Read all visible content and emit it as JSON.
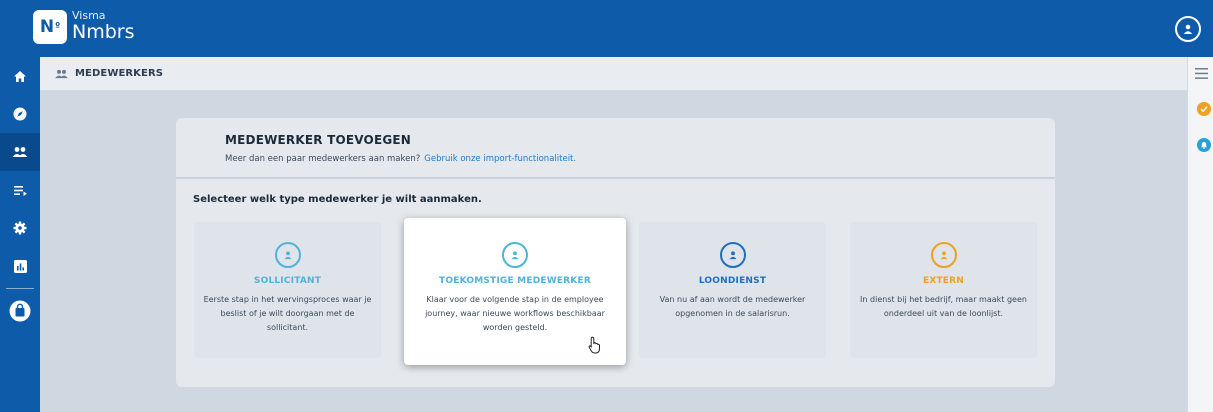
{
  "brand": {
    "logo_mark": "N",
    "logo_sup": "º",
    "small": "Visma",
    "big": "Nmbrs"
  },
  "header": {
    "user_icon": "user-avatar-icon"
  },
  "sidebar": {
    "items": [
      {
        "icon": "home-icon"
      },
      {
        "icon": "compass-icon"
      },
      {
        "icon": "employees-icon",
        "active": true
      },
      {
        "icon": "list-icon"
      },
      {
        "icon": "gear-icon"
      },
      {
        "icon": "chart-icon"
      },
      {
        "icon": "bag-icon"
      }
    ]
  },
  "breadcrumb": {
    "label": "MEDEWERKERS"
  },
  "card": {
    "title": "MEDEWERKER TOEVOEGEN",
    "subtitle": "Meer dan een paar medewerkers aan maken?",
    "import_link": "Gebruik onze import-functionaliteit.",
    "select_label": "Selecteer welk type medewerker je wilt aanmaken."
  },
  "options": [
    {
      "title": "SOLLICITANT",
      "color": "#4fb3d9",
      "desc": "Eerste stap in het wervingsproces waar je beslist of je wilt doorgaan met de sollicitant."
    },
    {
      "title": "TOEKOMSTIGE MEDEWERKER",
      "color": "#4fb3d9",
      "desc": "Klaar voor de volgende stap in de employee journey, waar nieuwe workflows beschikbaar worden gesteld."
    },
    {
      "title": "LOONDIENST",
      "color": "#1f6fc0",
      "desc": "Van nu af aan wordt de medewerker opgenomen in de salarisrun."
    },
    {
      "title": "EXTERN",
      "color": "#f0a020",
      "desc": "In dienst bij het bedrijf, maar maakt geen onderdeel uit van de loonlijst."
    }
  ],
  "colors": {
    "primary": "#0e5ba9",
    "notification_orange": "#f0a020",
    "notification_blue": "#2aa0d8"
  }
}
